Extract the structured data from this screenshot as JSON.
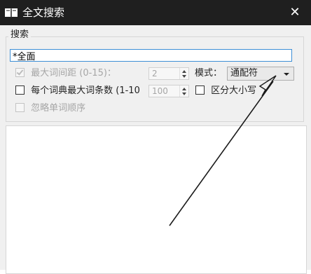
{
  "window": {
    "title": "全文搜索",
    "icon": "book-icon",
    "close": "✕"
  },
  "search": {
    "group_label": "搜索",
    "query": "*全面"
  },
  "options": {
    "max_word_gap": {
      "label": "最大词间距 (0-15)：",
      "checked": true,
      "disabled": true,
      "value": "2"
    },
    "mode": {
      "label": "模式：",
      "selected": "通配符"
    },
    "max_entries": {
      "label": "每个词典最大词条数 (1-10",
      "checked": false,
      "value": "100"
    },
    "case_sensitive": {
      "label": "区分大小写",
      "checked": false
    },
    "ignore_word_order": {
      "label": "忽略单词顺序",
      "checked": false,
      "disabled": true
    }
  }
}
